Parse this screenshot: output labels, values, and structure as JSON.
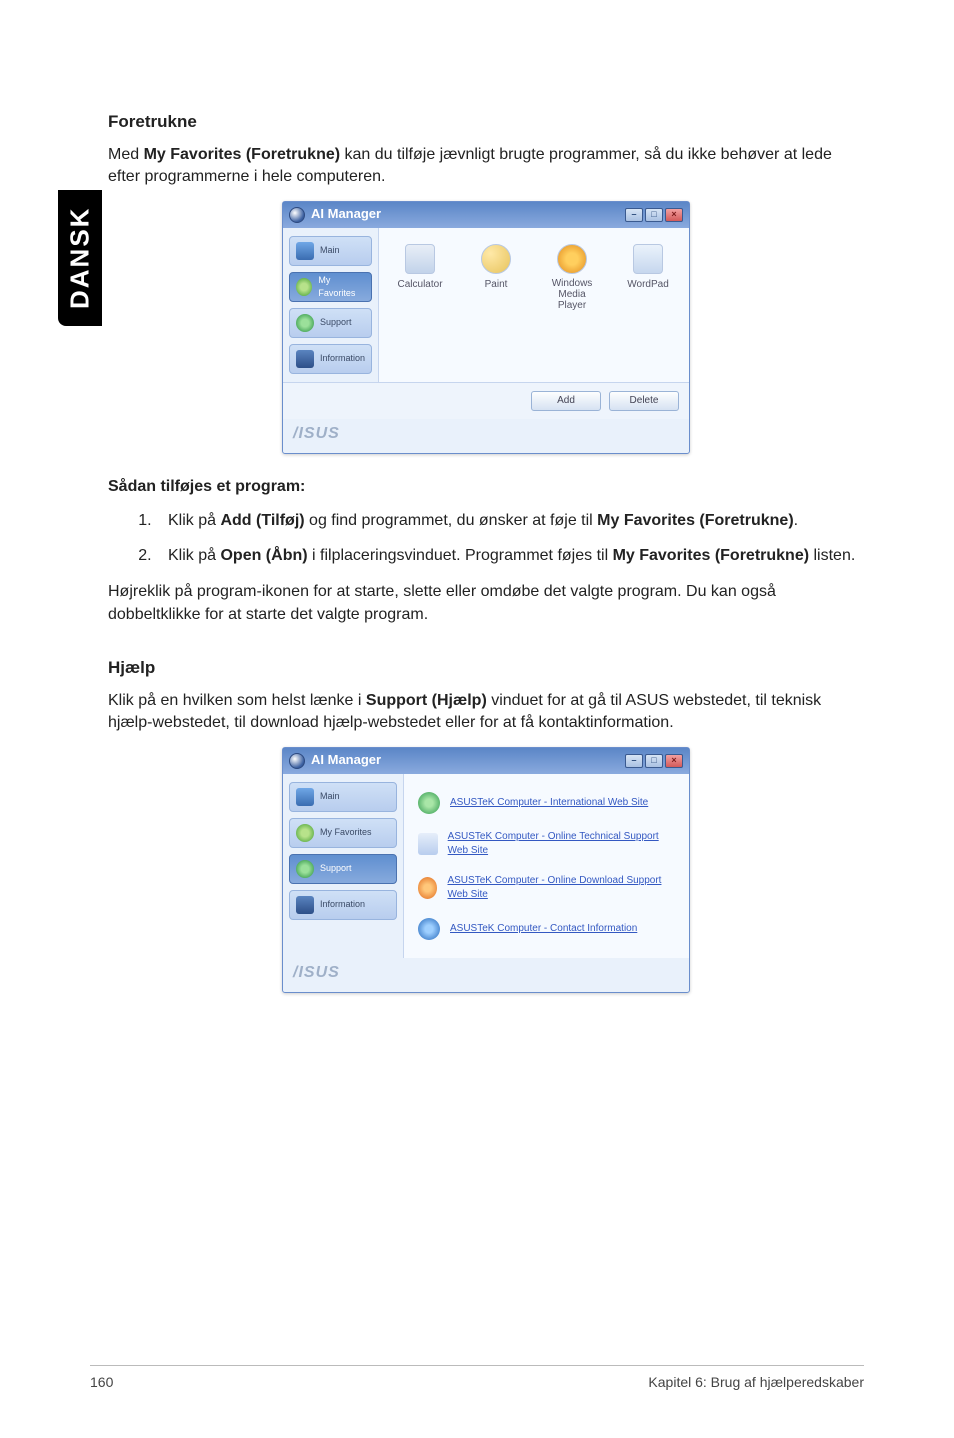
{
  "side_tab": "DANSK",
  "section1": {
    "heading": "Foretrukne",
    "intro_before": "Med ",
    "intro_bold": "My Favorites (Foretrukne)",
    "intro_after": " kan du tilføje jævnligt brugte programmer, så du ikke behøver at lede efter programmerne i hele computeren.",
    "screenshot": {
      "title": "AI Manager",
      "sidebar": {
        "main": "Main",
        "favorites": "My Favorites",
        "support": "Support",
        "info": "Information"
      },
      "fav_items": {
        "calc": "Calculator",
        "paint": "Paint",
        "wmp_line1": "Windows",
        "wmp_line2": "Media Player",
        "wordpad": "WordPad"
      },
      "buttons": {
        "add": "Add",
        "delete": "Delete"
      },
      "brand": "/ISUS"
    },
    "steps_heading": "Sådan tilføjes et program:",
    "step1_a": "Klik på ",
    "step1_b": "Add (Tilføj)",
    "step1_c": " og find programmet, du ønsker at føje til ",
    "step1_d": "My Favorites (Foretrukne)",
    "step1_e": ".",
    "step2_a": "Klik på ",
    "step2_b": "Open (Åbn)",
    "step2_c": " i filplaceringsvinduet. Programmet føjes til ",
    "step2_d": "My Favorites (Foretrukne)",
    "step2_e": " listen.",
    "after_steps": "Højreklik på program-ikonen for at starte, slette eller omdøbe det valgte program. Du kan også dobbeltklikke for at starte det valgte program."
  },
  "section2": {
    "heading": "Hjælp",
    "intro_before": "Klik på en hvilken som helst lænke i ",
    "intro_bold": "Support (Hjælp)",
    "intro_after": " vinduet for at gå til ASUS webstedet, til teknisk hjælp-webstedet, til download hjælp-webstedet eller for at få kontaktinformation.",
    "screenshot": {
      "title": "AI Manager",
      "sidebar": {
        "main": "Main",
        "favorites": "My Favorites",
        "support": "Support",
        "info": "Information"
      },
      "links": {
        "l1": "ASUSTeK Computer - International Web Site",
        "l2": "ASUSTeK Computer - Online Technical Support Web Site",
        "l3": "ASUSTeK Computer - Online Download Support Web Site",
        "l4": "ASUSTeK Computer - Contact Information"
      },
      "brand": "/ISUS"
    }
  },
  "footer": {
    "page": "160",
    "chapter": "Kapitel 6: Brug af hjælperedskaber"
  }
}
